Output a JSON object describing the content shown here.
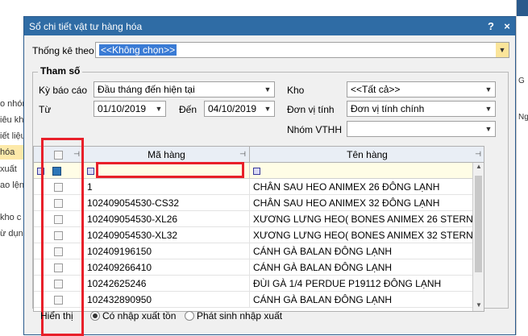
{
  "background": {
    "left_fragments": [
      "o nhón",
      "iêu kho",
      "iết liệu,",
      "hóa",
      "xuất",
      "ao lệnh",
      "kho c",
      "ừ dụng"
    ],
    "right_fragments": [
      "G",
      "Ng"
    ]
  },
  "dialog": {
    "title": "Sổ chi tiết vật tư hàng hóa",
    "help_label": "?",
    "close_label": "×",
    "stat_by_label": "Thống kê theo",
    "stat_by_value": "<<Không chọn>>",
    "params_title": "Tham số",
    "period_label": "Kỳ báo cáo",
    "period_value": "Đầu tháng đến hiện tại",
    "from_label": "Từ",
    "from_value": "01/10/2019",
    "to_label": "Đến",
    "to_value": "04/10/2019",
    "warehouse_label": "Kho",
    "warehouse_value": "<<Tất cả>>",
    "unit_label": "Đơn vị tính",
    "unit_value": "Đơn vị tính chính",
    "group_label": "Nhóm VTHH",
    "group_value": "",
    "display_label": "Hiển thị",
    "radio_1": "Có nhập xuất tồn",
    "radio_2": "Phát sinh nhập xuất"
  },
  "grid": {
    "col_code": "Mã hàng",
    "col_name": "Tên hàng",
    "rows": [
      {
        "code": "1",
        "name": "CHÂN SAU HEO ANIMEX 26 ĐÔNG LẠNH"
      },
      {
        "code": "102409054530-CS32",
        "name": "CHÂN SAU HEO ANIMEX 32 ĐÔNG LẠNH"
      },
      {
        "code": "102409054530-XL26",
        "name": "XƯƠNG LƯNG HEO( BONES ANIMEX 26 STERNU"
      },
      {
        "code": "102409054530-XL32",
        "name": "XƯƠNG LƯNG HEO( BONES ANIMEX 32 STERNU"
      },
      {
        "code": "102409196150",
        "name": "CÁNH GÀ BALAN ĐÔNG LẠNH"
      },
      {
        "code": "102409266410",
        "name": "CÁNH GÀ BALAN ĐÔNG LẠNH"
      },
      {
        "code": "10242625246",
        "name": "ĐÙI GÀ 1/4 PERDUE P19112 ĐÔNG LẠNH"
      },
      {
        "code": "102432890950",
        "name": "CÁNH GÀ BALAN ĐÔNG LẠNH"
      }
    ]
  },
  "colors": {
    "title_bar": "#2f6ca5",
    "highlight": "#e8202a",
    "filter_row": "#fffde6"
  }
}
